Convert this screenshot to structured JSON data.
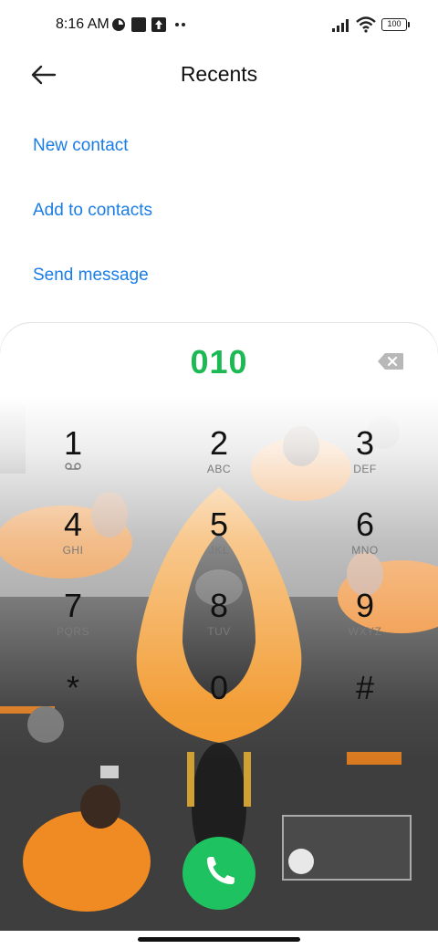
{
  "status_bar": {
    "time": "8:16 AM",
    "battery": "100",
    "left_icons": [
      "app-circle-icon",
      "square-app-icon",
      "upload-icon",
      "more-dots-icon"
    ],
    "right_icons": [
      "signal-icon",
      "wifi-icon",
      "battery-icon"
    ]
  },
  "app_bar": {
    "title": "Recents",
    "back_icon": "back-arrow-icon"
  },
  "actions": {
    "new_contact": "New contact",
    "add_to_contacts": "Add to contacts",
    "send_message": "Send message"
  },
  "dialer": {
    "number": "010",
    "backspace_icon": "backspace-icon",
    "call_icon": "phone-icon",
    "keys": [
      {
        "digit": "1",
        "letters": ""
      },
      {
        "digit": "2",
        "letters": "ABC"
      },
      {
        "digit": "3",
        "letters": "DEF"
      },
      {
        "digit": "4",
        "letters": "GHI"
      },
      {
        "digit": "5",
        "letters": "JKL"
      },
      {
        "digit": "6",
        "letters": "MNO"
      },
      {
        "digit": "7",
        "letters": "PQRS"
      },
      {
        "digit": "8",
        "letters": "TUV"
      },
      {
        "digit": "9",
        "letters": "WXYZ"
      },
      {
        "digit": "*",
        "letters": ""
      },
      {
        "digit": "0",
        "letters": ""
      },
      {
        "digit": "#",
        "letters": ""
      }
    ]
  },
  "colors": {
    "accent_link": "#1a7de6",
    "number": "#1db954",
    "call_button": "#1fc260",
    "wallpaper_orange": "#f29a2e"
  }
}
